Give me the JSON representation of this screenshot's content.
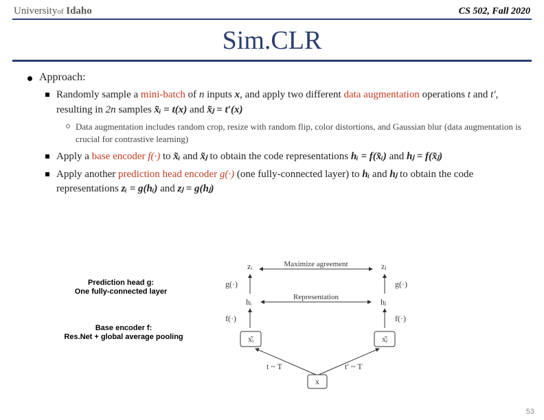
{
  "header": {
    "university_prefix": "University",
    "university_of": "of",
    "university_name": "Idaho",
    "course": "CS 502, Fall 2020"
  },
  "title": "Sim.CLR",
  "approach": {
    "label": "Approach:",
    "items": [
      {
        "pre": "Randomly sample a ",
        "red1": "mini-batch",
        "mid1": " of ",
        "n": "n",
        "mid2": " inputs ",
        "x": "x",
        "mid3": ", and apply two different ",
        "red2": "data augmentation",
        "mid4": " operations ",
        "t": "t",
        "and1": " and ",
        "tp": "t′",
        "mid5": ", resulting in ",
        "twon": "2n",
        "mid6": " samples ",
        "xi": "x͂ᵢ = t(x)",
        "and2": " and ",
        "xj": "x͂ⱼ = t′(x)",
        "sub": "Data augmentation includes random crop, resize with random flip, color distortions, and Gaussian blur (data augmentation is crucial for contrastive learning)"
      },
      {
        "pre": "Apply a ",
        "red1": "base encoder ",
        "f": "f(·)",
        "mid1": " to ",
        "xi": "x͂ᵢ",
        "and1": " and ",
        "xj": "x͂ⱼ",
        "mid2": " to obtain the code representations ",
        "hi": "hᵢ = f(x͂ᵢ)",
        "and2": " and ",
        "hj": "hⱼ = f(x͂ⱼ)"
      },
      {
        "pre": "Apply another ",
        "red1": "prediction head encoder ",
        "g": "g(·)",
        "mid1": " (one fully-connected layer) to ",
        "hi": "hᵢ",
        "and1": " and ",
        "hj": "hⱼ",
        "mid2": " to obtain the code representations ",
        "zi": "zᵢ = g(hᵢ)",
        "and2": " and ",
        "zj": "zⱼ = g(hⱼ)"
      }
    ]
  },
  "annotations": {
    "pred_head_l1": "Prediction head g:",
    "pred_head_l2": "One fully-connected layer",
    "base_enc_l1": "Base encoder f:",
    "base_enc_l2": "Res.Net + global average pooling"
  },
  "diagram": {
    "maximize": "Maximize agreement",
    "representation": "Representation",
    "zi": "zᵢ",
    "zj": "zⱼ",
    "hi": "hᵢ",
    "hj": "hⱼ",
    "xi": "x͂ᵢ",
    "xj": "x͂ⱼ",
    "x": "x",
    "g": "g(·)",
    "f": "f(·)",
    "tT": "t ~ T",
    "tpT": "t′ ~ T"
  },
  "page": "53"
}
